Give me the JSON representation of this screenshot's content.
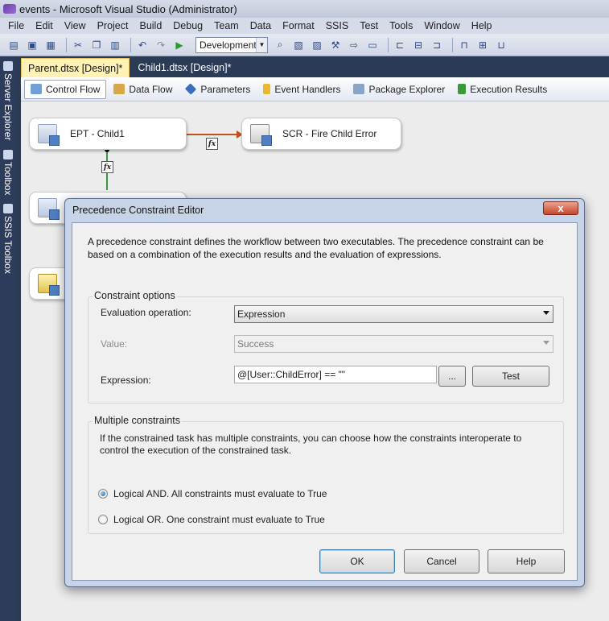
{
  "window": {
    "title": "events - Microsoft Visual Studio (Administrator)"
  },
  "menu": [
    "File",
    "Edit",
    "View",
    "Project",
    "Build",
    "Debug",
    "Team",
    "Data",
    "Format",
    "SSIS",
    "Test",
    "Tools",
    "Window",
    "Help"
  ],
  "toolbar": {
    "configuration": "Development"
  },
  "side_tabs": [
    "Server Explorer",
    "Toolbox",
    "SSIS Toolbox"
  ],
  "doc_tabs": [
    {
      "label": "Parent.dtsx [Design]*",
      "active": true
    },
    {
      "label": "Child1.dtsx [Design]*",
      "active": false
    }
  ],
  "designer_tabs": [
    {
      "label": "Control Flow",
      "icon": "control-flow-icon",
      "active": true
    },
    {
      "label": "Data Flow",
      "icon": "data-flow-icon",
      "active": false
    },
    {
      "label": "Parameters",
      "icon": "parameters-icon",
      "active": false
    },
    {
      "label": "Event Handlers",
      "icon": "event-handlers-icon",
      "active": false
    },
    {
      "label": "Package Explorer",
      "icon": "package-explorer-icon",
      "active": false
    },
    {
      "label": "Execution Results",
      "icon": "execution-results-icon",
      "active": false
    }
  ],
  "canvas": {
    "tasks": [
      {
        "label": "EPT - Child1",
        "icon": "execute-package-task-icon"
      },
      {
        "label": "SCR - Fire Child Error",
        "icon": "script-task-icon"
      }
    ],
    "constraint_colors": {
      "failure": "#c0501f",
      "success": "#3a9a3a"
    },
    "fx_label": "fx"
  },
  "dialog": {
    "title": "Precedence Constraint Editor",
    "close_label": "x",
    "description": "A precedence constraint defines the workflow between two executables. The precedence constraint can be based on a combination of the execution results and the evaluation of expressions.",
    "constraint_options": {
      "title": "Constraint options",
      "evaluation_label": "Evaluation operation:",
      "evaluation_value": "Expression",
      "value_label": "Value:",
      "value_value": "Success",
      "expression_label": "Expression:",
      "expression_value": "@[User::ChildError] == \"\"",
      "ellipsis_label": "...",
      "test_label": "Test"
    },
    "multiple_constraints": {
      "title": "Multiple constraints",
      "description": "If the constrained task has multiple constraints, you can choose how the constraints interoperate to control the execution of the constrained task.",
      "and_label": "Logical AND. All constraints must evaluate to True",
      "or_label": "Logical OR. One constraint must evaluate to True",
      "selected": "and"
    },
    "buttons": {
      "ok": "OK",
      "cancel": "Cancel",
      "help": "Help"
    }
  }
}
